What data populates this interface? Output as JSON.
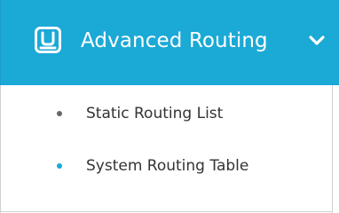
{
  "menu": {
    "title": "Advanced Routing",
    "icon": "router-icon",
    "chevron_icon": "chevron-down-icon",
    "header_color": "#1ba9d6",
    "items": [
      {
        "label": "Static Routing List",
        "bullet_color": "#666666",
        "active": false
      },
      {
        "label": "System Routing Table",
        "bullet_color": "#1ba9d6",
        "active": true
      }
    ]
  }
}
